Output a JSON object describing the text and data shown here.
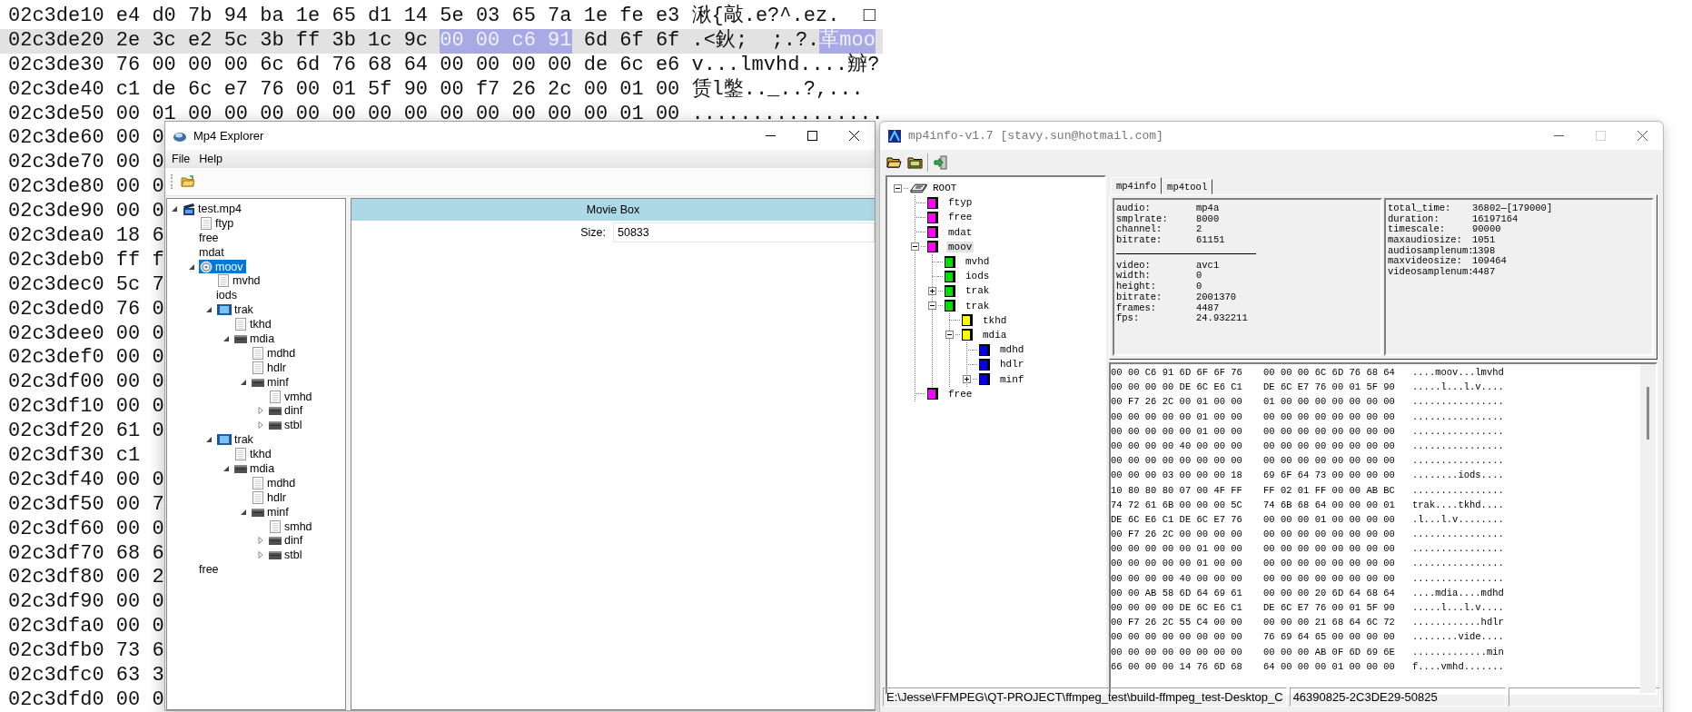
{
  "hex_editor": {
    "rows": [
      {
        "address": "02c3de10",
        "hex": "e4 d0 7b 94 ba 1e 65 d1 14 5e 03 65 7a 1e fe e3",
        "text": "湫{敲.e?^.ez.  □",
        "selected": false
      },
      {
        "address": "02c3de20",
        "hex": "2e 3c e2 5c 3b ff 3b 1c 9c",
        "hex_marked": "00 00 c6 91",
        "hex_after": "6d 6f 6f",
        "text": ".<鈥;  ;.?.",
        "text_marked": "革moo",
        "selected": true
      },
      {
        "address": "02c3de30",
        "hex": "76 00 00 00 6c 6d 76 68 64 00 00 00 00 de 6c e6",
        "text": "v...lmvhd....辧?",
        "selected": false
      },
      {
        "address": "02c3de40",
        "hex": "c1 de 6c e7 76 00 01 5f 90 00 f7 26 2c 00 01 00",
        "text": "赁l鐅.._..?,...",
        "selected": false
      },
      {
        "address": "02c3de50",
        "hex": "00 01 00 00 00 00 00 00 00 00 00 00 00 00 01 00",
        "text": "................",
        "selected": false
      },
      {
        "address": "02c3de60",
        "hex": "00 0",
        "selected": false
      },
      {
        "address": "02c3de70",
        "hex": "00 0",
        "selected": false
      },
      {
        "address": "02c3de80",
        "hex": "00 0",
        "selected": false
      },
      {
        "address": "02c3de90",
        "hex": "00 0",
        "selected": false
      },
      {
        "address": "02c3dea0",
        "hex": "18 6",
        "selected": false
      },
      {
        "address": "02c3deb0",
        "hex": "ff f",
        "selected": false
      },
      {
        "address": "02c3dec0",
        "hex": "5c 7",
        "selected": false
      },
      {
        "address": "02c3ded0",
        "hex": "76 0",
        "selected": false
      },
      {
        "address": "02c3dee0",
        "hex": "00 0",
        "selected": false
      },
      {
        "address": "02c3def0",
        "hex": "00 0",
        "selected": false
      },
      {
        "address": "02c3df00",
        "hex": "00 0",
        "selected": false
      },
      {
        "address": "02c3df10",
        "hex": "00 0",
        "selected": false
      },
      {
        "address": "02c3df20",
        "hex": "61 0",
        "selected": false
      },
      {
        "address": "02c3df30",
        "hex": "c1",
        "selected": false
      },
      {
        "address": "02c3df40",
        "hex": "00 0",
        "selected": false
      },
      {
        "address": "02c3df50",
        "hex": "00 7",
        "selected": false
      },
      {
        "address": "02c3df60",
        "hex": "00 0",
        "selected": false
      },
      {
        "address": "02c3df70",
        "hex": "68 6",
        "selected": false
      },
      {
        "address": "02c3df80",
        "hex": "00 2",
        "selected": false
      },
      {
        "address": "02c3df90",
        "hex": "00 0",
        "selected": false
      },
      {
        "address": "02c3dfa0",
        "hex": "00 0",
        "selected": false
      },
      {
        "address": "02c3dfb0",
        "hex": "73 6",
        "selected": false
      },
      {
        "address": "02c3dfc0",
        "hex": "63 3",
        "selected": false
      },
      {
        "address": "02c3dfd0",
        "hex": "00 0",
        "selected": false
      }
    ]
  },
  "explorer": {
    "title": "Mp4 Explorer",
    "menu": [
      "File",
      "Help"
    ],
    "tree": [
      {
        "label": "test.mp4",
        "kind": "movie",
        "selected": false,
        "expanded": true,
        "children": [
          {
            "label": "ftyp",
            "kind": "document",
            "selected": false
          },
          {
            "label": "free",
            "kind": "plain",
            "selected": false
          },
          {
            "label": "mdat",
            "kind": "plain",
            "selected": false
          },
          {
            "label": "moov",
            "kind": "atom",
            "selected": true,
            "expanded": true,
            "children": [
              {
                "label": "mvhd",
                "kind": "document",
                "selected": false
              },
              {
                "label": "iods",
                "kind": "plain",
                "selected": false
              },
              {
                "label": "trak",
                "kind": "track",
                "selected": false,
                "expanded": true,
                "children": [
                  {
                    "label": "tkhd",
                    "kind": "document",
                    "selected": false
                  },
                  {
                    "label": "mdia",
                    "kind": "box",
                    "selected": false,
                    "expanded": true,
                    "children": [
                      {
                        "label": "mdhd",
                        "kind": "document",
                        "selected": false
                      },
                      {
                        "label": "hdlr",
                        "kind": "document",
                        "selected": false
                      },
                      {
                        "label": "minf",
                        "kind": "box",
                        "selected": false,
                        "expanded": true,
                        "children": [
                          {
                            "label": "vmhd",
                            "kind": "document",
                            "selected": false
                          },
                          {
                            "label": "dinf",
                            "kind": "box",
                            "selected": false,
                            "expanded": false
                          },
                          {
                            "label": "stbl",
                            "kind": "box",
                            "selected": false,
                            "expanded": false
                          }
                        ]
                      }
                    ]
                  }
                ]
              },
              {
                "label": "trak",
                "kind": "track",
                "selected": false,
                "expanded": true,
                "children": [
                  {
                    "label": "tkhd",
                    "kind": "document",
                    "selected": false
                  },
                  {
                    "label": "mdia",
                    "kind": "box",
                    "selected": false,
                    "expanded": true,
                    "children": [
                      {
                        "label": "mdhd",
                        "kind": "document",
                        "selected": false
                      },
                      {
                        "label": "hdlr",
                        "kind": "document",
                        "selected": false
                      },
                      {
                        "label": "minf",
                        "kind": "box",
                        "selected": false,
                        "expanded": true,
                        "children": [
                          {
                            "label": "smhd",
                            "kind": "document",
                            "selected": false
                          },
                          {
                            "label": "dinf",
                            "kind": "box",
                            "selected": false,
                            "expanded": false
                          },
                          {
                            "label": "stbl",
                            "kind": "box",
                            "selected": false,
                            "expanded": false
                          }
                        ]
                      }
                    ]
                  }
                ]
              }
            ]
          },
          {
            "label": "free",
            "kind": "plain",
            "selected": false
          }
        ]
      }
    ],
    "detail": {
      "title": "Movie Box",
      "fields": [
        {
          "label": "Size:",
          "value": "50833"
        }
      ]
    }
  },
  "mp4info": {
    "title": "mp4info-v1.7 [stavy.sun@hotmail.com]",
    "tree": [
      {
        "label": "ROOT",
        "kind": "root",
        "selected": false,
        "expanded": true,
        "children": [
          {
            "label": "ftyp",
            "kind": "atom",
            "color": "#ff00ff",
            "selected": false
          },
          {
            "label": "free",
            "kind": "atom",
            "color": "#ff00ff",
            "selected": false
          },
          {
            "label": "mdat",
            "kind": "atom",
            "color": "#ff00ff",
            "selected": false
          },
          {
            "label": "moov",
            "kind": "atom",
            "color": "#ff00ff",
            "selected": true,
            "expanded": true,
            "children": [
              {
                "label": "mvhd",
                "kind": "atom",
                "color": "#00e000",
                "selected": false
              },
              {
                "label": "iods",
                "kind": "atom",
                "color": "#00e000",
                "selected": false
              },
              {
                "label": "trak",
                "kind": "atom",
                "color": "#00e000",
                "selected": false,
                "expanded": false
              },
              {
                "label": "trak",
                "kind": "atom",
                "color": "#00e000",
                "selected": false,
                "expanded": true,
                "children": [
                  {
                    "label": "tkhd",
                    "kind": "atom",
                    "color": "#ffff00",
                    "selected": false
                  },
                  {
                    "label": "mdia",
                    "kind": "atom",
                    "color": "#ffff00",
                    "selected": false,
                    "expanded": true,
                    "children": [
                      {
                        "label": "mdhd",
                        "kind": "atom",
                        "color": "#0000ff",
                        "selected": false
                      },
                      {
                        "label": "hdlr",
                        "kind": "atom",
                        "color": "#0000ff",
                        "selected": false
                      },
                      {
                        "label": "minf",
                        "kind": "atom",
                        "color": "#0000ff",
                        "selected": false,
                        "expanded": false
                      }
                    ]
                  }
                ]
              }
            ]
          },
          {
            "label": "free",
            "kind": "atom",
            "color": "#ff00ff",
            "selected": false
          }
        ]
      }
    ],
    "tabs": [
      {
        "label": "mp4info",
        "selected": true
      },
      {
        "label": "mp4tool",
        "selected": false
      }
    ],
    "audio": [
      {
        "label": "audio:",
        "value": "mp4a"
      },
      {
        "label": "smplrate:",
        "value": "8000"
      },
      {
        "label": "channel:",
        "value": "2"
      },
      {
        "label": "bitrate:",
        "value": "61151"
      }
    ],
    "video": [
      {
        "label": "video:",
        "value": "avc1"
      },
      {
        "label": "width:",
        "value": "0"
      },
      {
        "label": "height:",
        "value": "0"
      },
      {
        "label": "bitrate:",
        "value": "2001370"
      },
      {
        "label": "frames:",
        "value": "4487"
      },
      {
        "label": "fps:",
        "value": "24.932211"
      }
    ],
    "totals": [
      {
        "label": "total_time:",
        "value": "36802—[179000]"
      },
      {
        "label": "duration:",
        "value": "16197164"
      },
      {
        "label": "timescale:",
        "value": "90000"
      },
      {
        "label": "maxaudiosize:",
        "value": "1051"
      },
      {
        "label": "audiosamplenum:",
        "value": "1398"
      },
      {
        "label": "maxvideosize:",
        "value": "109464"
      },
      {
        "label": "videosamplenum:",
        "value": "4487"
      }
    ],
    "hex_dump": [
      {
        "group_1": "00 00 C6 91 6D 6F 6F 76",
        "group_2": "00 00 00 6C 6D 76 68 64",
        "text": "....moov...lmvhd"
      },
      {
        "group_1": "00 00 00 00 DE 6C E6 C1",
        "group_2": "DE 6C E7 76 00 01 5F 90",
        "text": ".....l...l.v...."
      },
      {
        "group_1": "00 F7 26 2C 00 01 00 00",
        "group_2": "01 00 00 00 00 00 00 00",
        "text": "................"
      },
      {
        "group_1": "00 00 00 00 00 01 00 00",
        "group_2": "00 00 00 00 00 00 00 00",
        "text": "................"
      },
      {
        "group_1": "00 00 00 00 00 01 00 00",
        "group_2": "00 00 00 00 00 00 00 00",
        "text": "................"
      },
      {
        "group_1": "00 00 00 00 40 00 00 00",
        "group_2": "00 00 00 00 00 00 00 00",
        "text": "................"
      },
      {
        "group_1": "00 00 00 00 00 00 00 00",
        "group_2": "00 00 00 00 00 00 00 00",
        "text": "................"
      },
      {
        "group_1": "00 00 00 03 00 00 00 18",
        "group_2": "69 6F 64 73 00 00 00 00",
        "text": "........iods...."
      },
      {
        "group_1": "10 80 80 80 07 00 4F FF",
        "group_2": "FF 02 01 FF 00 00 AB BC",
        "text": "................"
      },
      {
        "group_1": "74 72 61 6B 00 00 00 5C",
        "group_2": "74 6B 68 64 00 00 00 01",
        "text": "trak....tkhd...."
      },
      {
        "group_1": "DE 6C E6 C1 DE 6C E7 76",
        "group_2": "00 00 00 01 00 00 00 00",
        "text": ".l...l.v........"
      },
      {
        "group_1": "00 F7 26 2C 00 00 00 00",
        "group_2": "00 00 00 00 00 00 00 00",
        "text": "................"
      },
      {
        "group_1": "00 00 00 00 00 01 00 00",
        "group_2": "00 00 00 00 00 00 00 00",
        "text": "................"
      },
      {
        "group_1": "00 00 00 00 00 01 00 00",
        "group_2": "00 00 00 00 00 00 00 00",
        "text": "................"
      },
      {
        "group_1": "00 00 00 00 40 00 00 00",
        "group_2": "00 00 00 00 00 00 00 00",
        "text": "................"
      },
      {
        "group_1": "00 00 AB 58 6D 64 69 61",
        "group_2": "00 00 00 20 6D 64 68 64",
        "text": "....mdia....mdhd"
      },
      {
        "group_1": "00 00 00 00 DE 6C E6 C1",
        "group_2": "DE 6C E7 76 00 01 5F 90",
        "text": ".....l...l.v...."
      },
      {
        "group_1": "00 F7 26 2C 55 C4 00 00",
        "group_2": "00 00 00 21 68 64 6C 72",
        "text": "............hdlr"
      },
      {
        "group_1": "00 00 00 00 00 00 00 00",
        "group_2": "76 69 64 65 00 00 00 00",
        "text": "........vide...."
      },
      {
        "group_1": "00 00 00 00 00 00 00 00",
        "group_2": "00 00 00 AB 0F 6D 69 6E",
        "text": ".............min"
      },
      {
        "group_1": "66 00 00 00 14 76 6D 68",
        "group_2": "64 00 00 00 01 00 00 00",
        "text": "f....vmhd......."
      }
    ],
    "status_bar": [
      "E:\\Jesse\\FFMPEG\\QT-PROJECT\\ffmpeg_test\\build-ffmpeg_test-Desktop_C",
      "46390825-2C3DE29-50825"
    ]
  }
}
